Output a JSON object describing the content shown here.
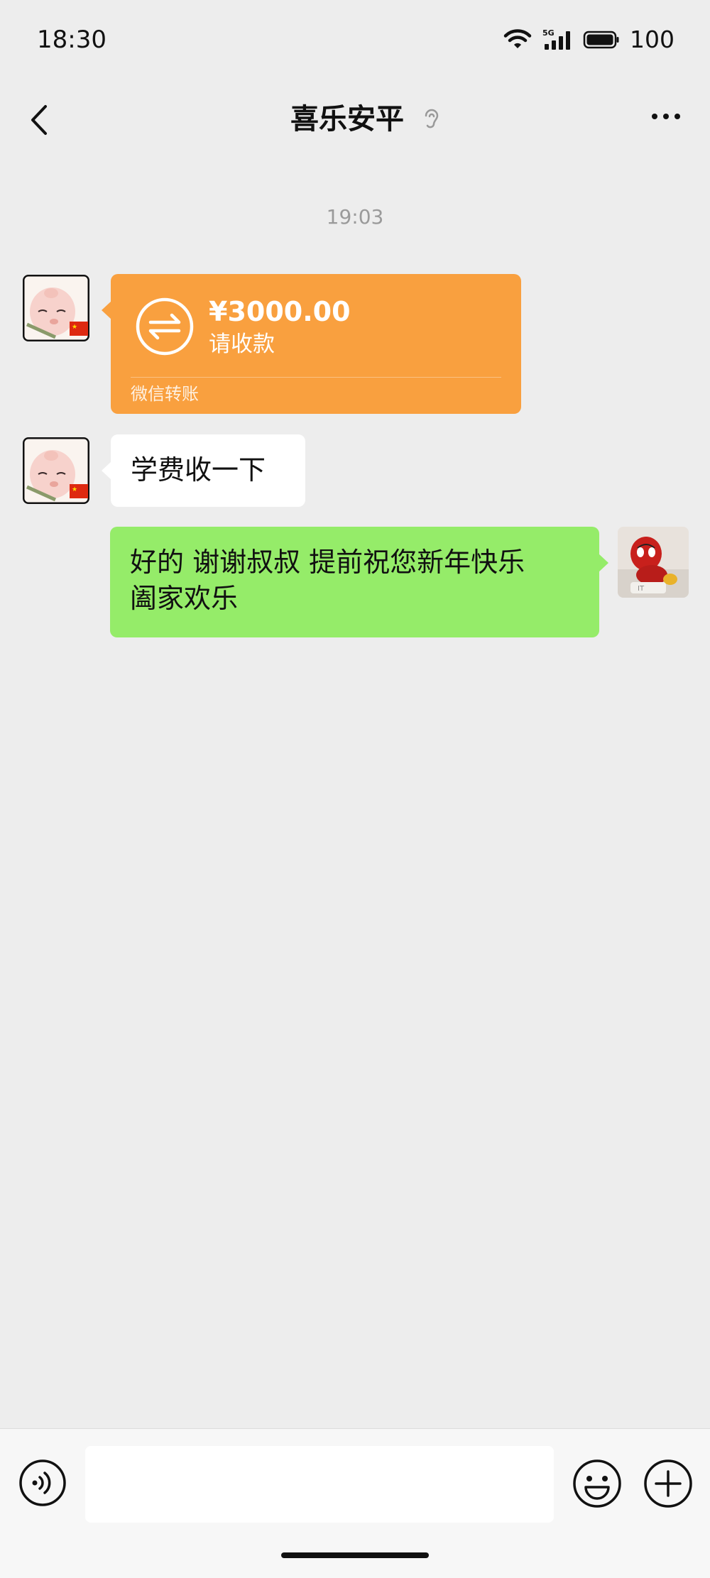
{
  "status_bar": {
    "time": "18:30",
    "network": "5G",
    "battery": "100",
    "icons": [
      "wifi-icon",
      "signal-5g-icon",
      "battery-icon"
    ]
  },
  "nav": {
    "title": "喜乐安平",
    "icons": [
      "back-chevron-icon",
      "ear-icon",
      "more-dots-icon"
    ]
  },
  "chat": {
    "timestamp": "19:03",
    "messages": [
      {
        "type": "transfer",
        "direction": "incoming",
        "amount": "¥3000.00",
        "status": "请收款",
        "footer": "微信转账",
        "color": "#f9a03f"
      },
      {
        "type": "text",
        "direction": "incoming",
        "text": "学费收一下",
        "color": "#ffffff"
      },
      {
        "type": "text",
        "direction": "outgoing",
        "line1": "好的 谢谢叔叔 提前祝您新年快乐",
        "line2": "阖家欢乐",
        "color": "#95ec69"
      }
    ]
  },
  "input_bar": {
    "value": "",
    "placeholder": "",
    "icons": [
      "voice-icon",
      "emoji-icon",
      "plus-icon"
    ]
  },
  "colors": {
    "background": "#ededed",
    "outgoing_bubble": "#95ec69",
    "incoming_bubble": "#ffffff",
    "transfer_card": "#f9a03f",
    "timestamp": "#9a9a9a"
  }
}
